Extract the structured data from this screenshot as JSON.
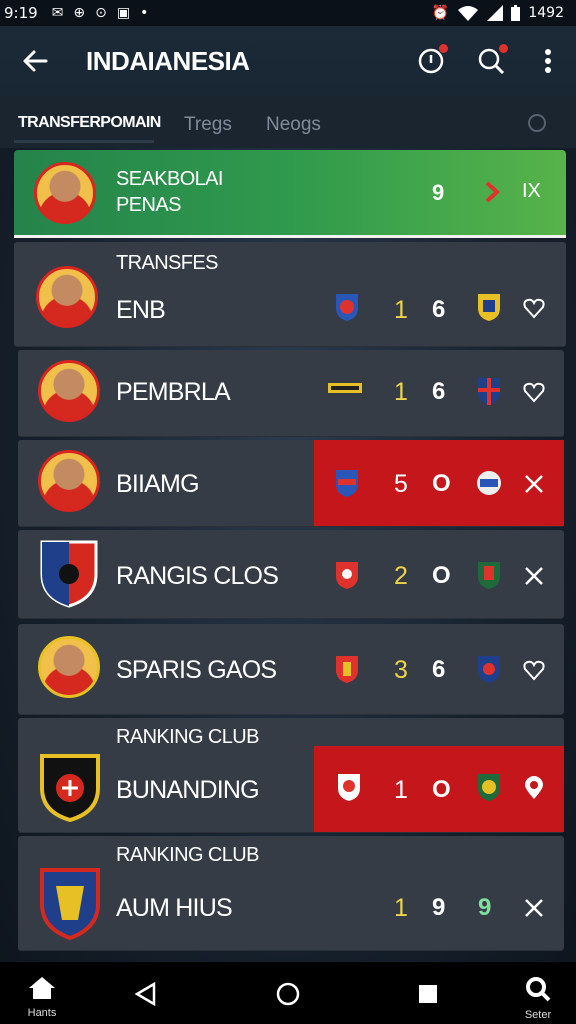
{
  "status_bar": {
    "time": "9:19",
    "battery": "1492"
  },
  "app_bar": {
    "title": "INDAIANESIA"
  },
  "tabs": [
    {
      "label": "TRANSFERPOMAIN"
    },
    {
      "label": "Tregs"
    },
    {
      "label": "Neogs"
    }
  ],
  "featured": {
    "line1": "SEAKBOLAI",
    "line2": "PENAS",
    "stat": "9",
    "action": "IX"
  },
  "rows": [
    {
      "label": "TRANSFES",
      "name": "ENB",
      "num": "1",
      "stat": "6"
    },
    {
      "name": "PEMBRLA",
      "num": "1",
      "stat": "6"
    },
    {
      "name": "BIIAMG",
      "num": "5",
      "stat": "O"
    },
    {
      "name": "RANGIS CLOS",
      "num": "2",
      "stat": "O"
    },
    {
      "name": "SPARIS GAOS",
      "num": "3",
      "stat": "6"
    },
    {
      "label": "RANKING CLUB",
      "name": "BUNANDING",
      "num": "1",
      "stat": "O"
    },
    {
      "label": "RANKING CLUB",
      "name": "AUM HIUS",
      "num": "1",
      "stat": "9",
      "stat2": "9"
    }
  ],
  "nav_bar": {
    "home_label": "Hants",
    "search_label": "Seter"
  },
  "colors": {
    "featured_green": "#2f9a4d",
    "highlight_red": "#c4161b",
    "number_yellow": "#ecd54a"
  }
}
